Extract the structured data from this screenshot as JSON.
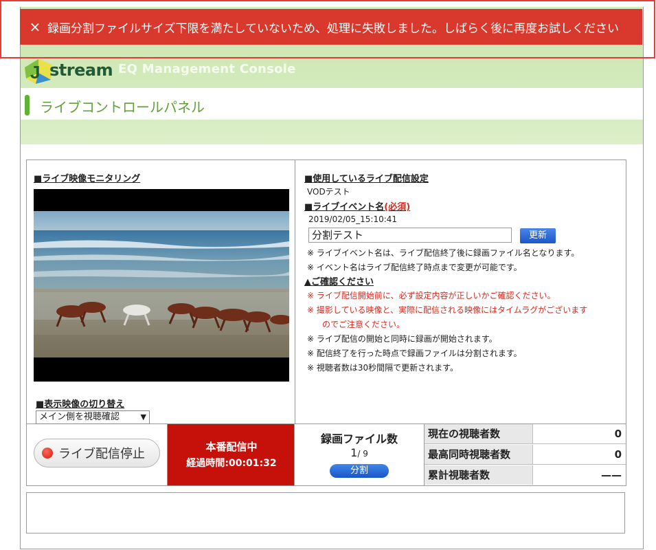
{
  "error": {
    "close_icon": "×",
    "message": "録画分割ファイルサイズ下限を満たしていないため、処理に失敗しました。しばらく後に再度お試しください"
  },
  "header": {
    "logo_text": "stream",
    "logo_j": "J",
    "console_title": "EQ Management Console",
    "page_title": "ライブコントロールパネル"
  },
  "monitor": {
    "title": "■ライブ映像モニタリング",
    "switch_title": "■表示映像の切り替え",
    "switch_selected": "メイン側を視聴確認",
    "switch_arrow": "▼"
  },
  "settings": {
    "title": "■使用しているライブ配信設定",
    "value": "VODテスト",
    "event_title": "■ライブイベント名",
    "required": "(必須)",
    "event_date": "2019/02/05_15:10:41",
    "event_name": "分割テスト",
    "update_button": "更新",
    "note1": "※ ライブイベント名は、ライブ配信終了後に録画ファイル名となります。",
    "note2": "※ イベント名はライブ配信終了時点まで変更が可能です。",
    "confirm_title": "▲ご確認ください",
    "warn1": "※ ライブ配信開始前に、必ず設定内容が正しいかご確認ください。",
    "warn2": "※ 撮影している映像と、実際に配信される映像にはタイムラグがございます",
    "warn3": "のでご注意ください。",
    "note3": "※ ライブ配信の開始と同時に録画が開始されます。",
    "note4": "※ 配信終了を行った時点で録画ファイルは分割されます。",
    "note5": "※ 視聴者数は30秒間隔で更新されます。"
  },
  "controls": {
    "stop_button": "ライブ配信停止",
    "live_status": "本番配信中",
    "elapsed": "経過時間:00:01:32",
    "rec_title": "録画ファイル数",
    "rec_current": "1",
    "rec_total": "/ 9",
    "split_button": "分割"
  },
  "stats": [
    {
      "label": "現在の視聴者数",
      "value": "0"
    },
    {
      "label": "最高同時視聴者数",
      "value": "0"
    },
    {
      "label": "累計視聴者数",
      "value": "——"
    }
  ]
}
